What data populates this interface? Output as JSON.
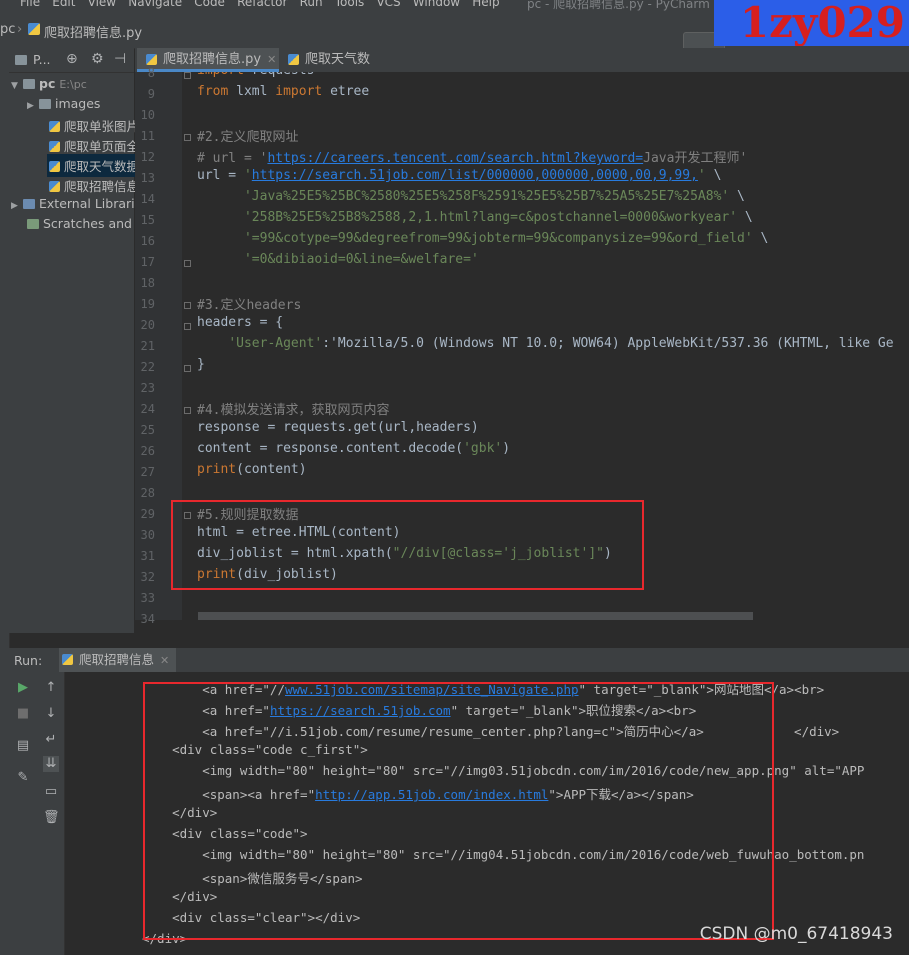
{
  "menu": [
    "File",
    "Edit",
    "View",
    "Navigate",
    "Code",
    "Refactor",
    "Run",
    "Tools",
    "VCS",
    "Window",
    "Help"
  ],
  "window_title": "pc - 爬取招聘信息.py - PyCharm",
  "watermark": "1zy029",
  "breadcrumb": {
    "project": "pc",
    "file": "爬取招聘信息.py"
  },
  "project_panel": {
    "title": "P...",
    "root_name": "pc",
    "root_path": "E:\\pc",
    "items": [
      "images",
      "爬取单张图片",
      "爬取单页面全",
      "爬取天气数据",
      "爬取招聘信息",
      "External Librari",
      "Scratches and C"
    ]
  },
  "editor_tabs": [
    "爬取招聘信息.py",
    "爬取天气数据.py"
  ],
  "code_lines": [
    {
      "n": "8",
      "t": "import requests"
    },
    {
      "n": "9",
      "t": "from lxml import etree"
    },
    {
      "n": "10",
      "t": ""
    },
    {
      "n": "11",
      "t": "#2.定义爬取网址"
    },
    {
      "n": "12",
      "t": "# url = 'https://careers.tencent.com/search.html?keyword=Java开发工程师'"
    },
    {
      "n": "13",
      "t": "url = 'https://search.51job.com/list/000000,000000,0000,00,9,99,' \\"
    },
    {
      "n": "14",
      "t": "      'Java%25E5%25BC%2580%25E5%258F%2591%25E5%25B7%25A5%25E7%25A8%' \\"
    },
    {
      "n": "15",
      "t": "      '258B%25E5%25B8%2588,2,1.html?lang=c&postchannel=0000&workyear' \\"
    },
    {
      "n": "16",
      "t": "      '=99&cotype=99&degreefrom=99&jobterm=99&companysize=99&ord_field' \\"
    },
    {
      "n": "17",
      "t": "      '=0&dibiaoid=0&line=&welfare='"
    },
    {
      "n": "18",
      "t": ""
    },
    {
      "n": "19",
      "t": "#3.定义headers"
    },
    {
      "n": "20",
      "t": "headers = {"
    },
    {
      "n": "21",
      "t": "    'User-Agent':'Mozilla/5.0 (Windows NT 10.0; WOW64) AppleWebKit/537.36 (KHTML, like Ge"
    },
    {
      "n": "22",
      "t": "}"
    },
    {
      "n": "23",
      "t": ""
    },
    {
      "n": "24",
      "t": "#4.模拟发送请求，获取网页内容"
    },
    {
      "n": "25",
      "t": "response = requests.get(url,headers)"
    },
    {
      "n": "26",
      "t": "content = response.content.decode('gbk')"
    },
    {
      "n": "27",
      "t": "print(content)"
    },
    {
      "n": "28",
      "t": ""
    },
    {
      "n": "29",
      "t": "#5.规则提取数据"
    },
    {
      "n": "30",
      "t": "html = etree.HTML(content)"
    },
    {
      "n": "31",
      "t": "div_joblist = html.xpath(\"//div[@class='j_joblist']\")"
    },
    {
      "n": "32",
      "t": "print(div_joblist)"
    },
    {
      "n": "33",
      "t": ""
    },
    {
      "n": "34",
      "t": ""
    }
  ],
  "run_panel": {
    "label": "Run:",
    "tab": "爬取招聘信息"
  },
  "console_lines": [
    "        <a href=\"//www.51job.com/sitemap/site_Navigate.php\" target=\"_blank\">网站地图</a><br>",
    "        <a href=\"https://search.51job.com\" target=\"_blank\">职位搜索</a><br>",
    "        <a href=\"//i.51job.com/resume/resume_center.php?lang=c\">简历中心</a>            </div>",
    "    <div class=\"code c_first\">",
    "        <img width=\"80\" height=\"80\" src=\"//img03.51jobcdn.com/im/2016/code/new_app.png\" alt=\"APP",
    "        <span><a href=\"http://app.51job.com/index.html\">APP下载</a></span>",
    "    </div>",
    "    <div class=\"code\">",
    "        <img width=\"80\" height=\"80\" src=\"//img04.51jobcdn.com/im/2016/code/web_fuwuhao_bottom.pn",
    "        <span>微信服务号</span>",
    "    </div>",
    "    <div class=\"clear\"></div>",
    "</div>"
  ],
  "credit": "CSDN @m0_67418943"
}
